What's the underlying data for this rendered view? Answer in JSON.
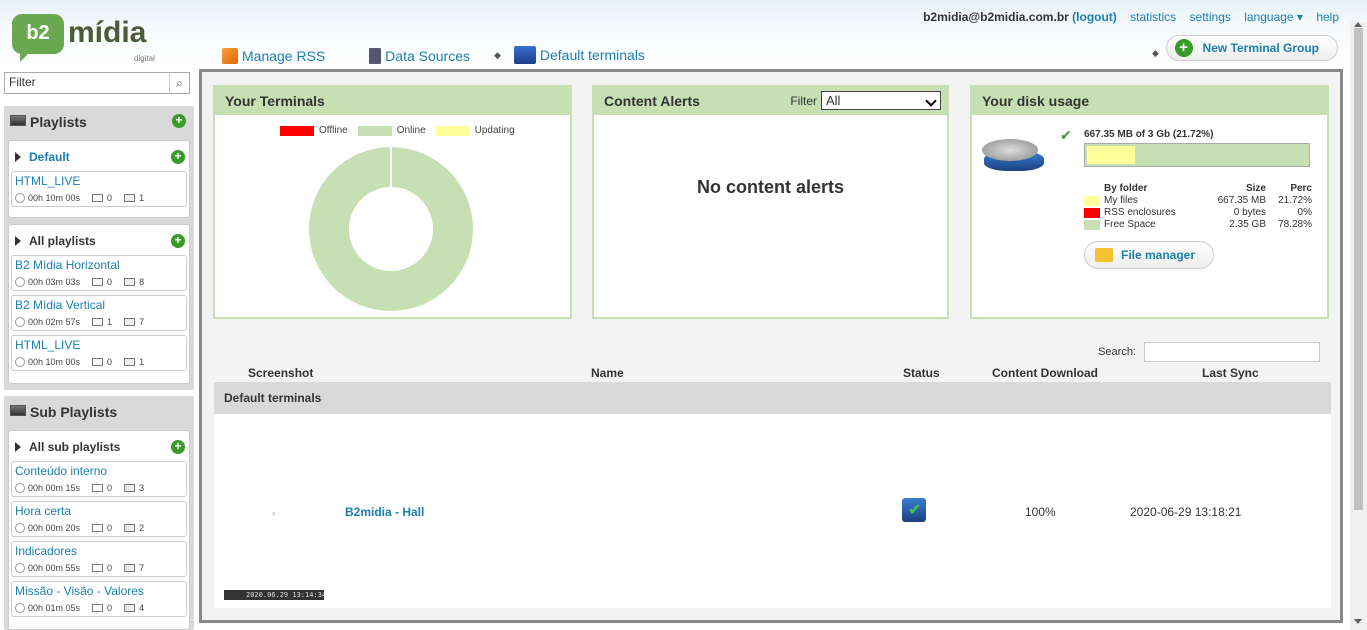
{
  "header": {
    "logo_text": "b2",
    "logo_word": "mídia",
    "logo_sub": "digital",
    "user": "b2midia@b2midia.com.br",
    "logout": "(logout)",
    "links": [
      "statistics",
      "settings",
      "language ▾",
      "help"
    ],
    "nav": [
      "Manage RSS",
      "Data Sources",
      "Default terminals"
    ],
    "new_group": "New Terminal Group"
  },
  "sidebar": {
    "filter_value": "Filter",
    "playlists_title": "Playlists",
    "default_group": "Default",
    "default_items": [
      {
        "name": "HTML_LIVE",
        "time": "00h 10m 00s",
        "terminals": "0",
        "count": "1"
      }
    ],
    "all_group": "All playlists",
    "all_items": [
      {
        "name": "B2 Mídia Horizontal",
        "time": "00h 03m 03s",
        "terminals": "0",
        "count": "8"
      },
      {
        "name": "B2 Mídia Vertical",
        "time": "00h 02m 57s",
        "terminals": "1",
        "count": "7"
      },
      {
        "name": "HTML_LIVE",
        "time": "00h 10m 00s",
        "terminals": "0",
        "count": "1"
      }
    ],
    "sub_title": "Sub Playlists",
    "sub_group": "All sub playlists",
    "sub_items": [
      {
        "name": "Conteúdo interno",
        "time": "00h 00m 15s",
        "terminals": "0",
        "count": "3"
      },
      {
        "name": "Hora certa",
        "time": "00h 00m 20s",
        "terminals": "0",
        "count": "2"
      },
      {
        "name": "Indicadores",
        "time": "00h 00m 55s",
        "terminals": "0",
        "count": "7"
      },
      {
        "name": "Missão - Visão - Valores",
        "time": "00h 01m 05s",
        "terminals": "0",
        "count": "4"
      }
    ]
  },
  "terminals_box": {
    "title": "Your Terminals",
    "legend": [
      {
        "label": "Offline",
        "color": "#ff0000"
      },
      {
        "label": "Online",
        "color": "#c6e0b4"
      },
      {
        "label": "Updating",
        "color": "#ffff99"
      }
    ]
  },
  "alerts_box": {
    "title": "Content Alerts",
    "filter_label": "Filter",
    "filter_value": "All",
    "empty": "No content alerts"
  },
  "disk_box": {
    "title": "Your disk usage",
    "summary": "667.35 MB of 3 Gb (21.72%)",
    "used_fraction": 0.2172,
    "head": {
      "c1": "By folder",
      "c2": "Size",
      "c3": "Perc"
    },
    "rows": [
      {
        "label": "My files",
        "size": "667.35 MB",
        "perc": "21.72%",
        "color": "#ffff99"
      },
      {
        "label": "RSS enclosures",
        "size": "0 bytes",
        "perc": "0%",
        "color": "#ff0000"
      },
      {
        "label": "Free Space",
        "size": "2.35 GB",
        "perc": "78.28%",
        "color": "#c6e0b4"
      }
    ],
    "file_manager": "File manager"
  },
  "table": {
    "search_label": "Search:",
    "columns": [
      "Screenshot",
      "Name",
      "Status",
      "Content Download",
      "Last Sync"
    ],
    "group": "Default terminals",
    "row": {
      "name": "B2midia - Hall",
      "download": "100%",
      "sync": "2020-06-29 13:18:21",
      "screenshot_caption": "2020.06.29 13:14:34"
    }
  }
}
